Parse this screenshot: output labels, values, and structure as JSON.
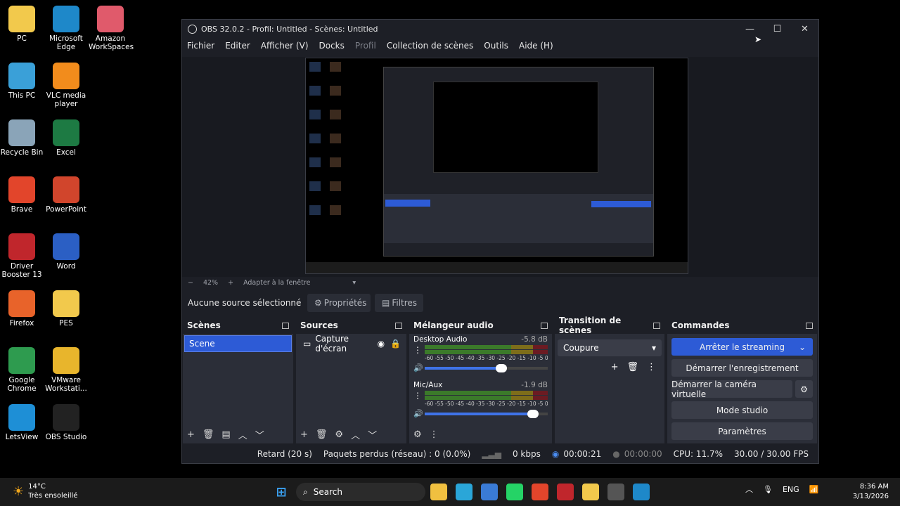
{
  "desktop": {
    "icons": [
      {
        "label": "PC",
        "color": "#f2c94c"
      },
      {
        "label": "Microsoft Edge",
        "color": "#1e88c9"
      },
      {
        "label": "Amazon WorkSpaces",
        "color": "#e05a6b"
      },
      {
        "label": "This PC",
        "color": "#3aa0d8"
      },
      {
        "label": "VLC media player",
        "color": "#f28c1c"
      },
      {
        "label": "Recycle Bin",
        "color": "#8aa4b8"
      },
      {
        "label": "Excel",
        "color": "#1d7a43"
      },
      {
        "label": "Brave",
        "color": "#e2452b"
      },
      {
        "label": "PowerPoint",
        "color": "#d1452c"
      },
      {
        "label": "Driver Booster 13",
        "color": "#c0262c"
      },
      {
        "label": "Word",
        "color": "#2b5fc4"
      },
      {
        "label": "Firefox",
        "color": "#e8632a"
      },
      {
        "label": "PES",
        "color": "#f2c94c"
      },
      {
        "label": "Google Chrome",
        "color": "#2e9b4f"
      },
      {
        "label": "VMware Workstati...",
        "color": "#e8b52c"
      },
      {
        "label": "LetsView",
        "color": "#1e8fd6"
      },
      {
        "label": "OBS Studio",
        "color": "#222"
      }
    ]
  },
  "window": {
    "title": "OBS 32.0.2 - Profil: Untitled - Scènes: Untitled",
    "menu": [
      "Fichier",
      "Editer",
      "Afficher (V)",
      "Docks",
      "Profil",
      "Collection de scènes",
      "Outils",
      "Aide (H)"
    ],
    "zoom": {
      "minus": "−",
      "value": "42%",
      "plus": "+",
      "fit": "Adapter à la fenêtre"
    },
    "source_bar": {
      "status": "Aucune source sélectionné",
      "properties": "Propriétés",
      "filters": "Filtres"
    }
  },
  "docks": {
    "scenes": {
      "title": "Scènes",
      "items": [
        "Scene"
      ]
    },
    "sources": {
      "title": "Sources",
      "items": [
        "Capture d'écran"
      ]
    },
    "mixer": {
      "title": "Mélangeur audio",
      "channels": [
        {
          "name": "Desktop Audio",
          "db": "-5.8 dB",
          "level": 0.62
        },
        {
          "name": "Mic/Aux",
          "db": "-1.9 dB",
          "level": 0.88
        }
      ],
      "scale": "-60 -55 -50 -45 -40 -35 -30 -25 -20 -15 -10 -5 0"
    },
    "transitions": {
      "title": "Transition de scènes",
      "selected": "Coupure"
    },
    "controls": {
      "title": "Commandes",
      "stream": "Arrêter le streaming",
      "record": "Démarrer l'enregistrement",
      "virtualcam": "Démarrer la caméra virtuelle",
      "studio": "Mode studio",
      "settings": "Paramètres"
    }
  },
  "status": {
    "delay": "Retard (20 s)",
    "dropped": "Paquets perdus (réseau) : 0 (0.0%)",
    "kbps": "0 kbps",
    "stream_time": "00:00:21",
    "rec_time": "00:00:00",
    "cpu": "CPU: 11.7%",
    "fps": "30.00 / 30.00 FPS"
  },
  "taskbar": {
    "weather_temp": "14°C",
    "weather_text": "Très ensoleillé",
    "search": "Search",
    "lang": "ENG",
    "time": "8:36 AM",
    "date": "3/13/2026"
  }
}
